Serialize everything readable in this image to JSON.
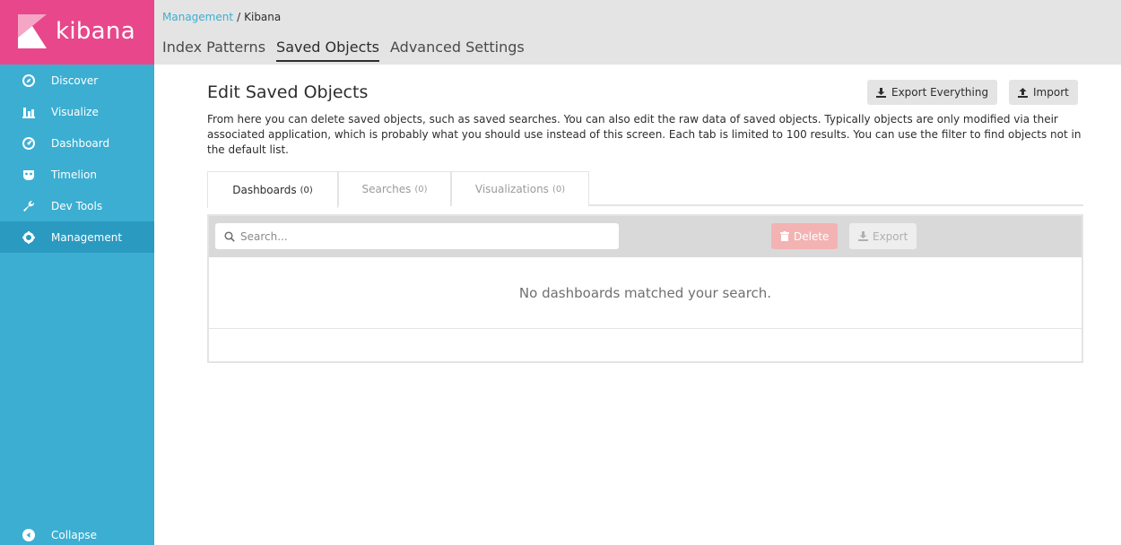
{
  "app": {
    "name": "kibana",
    "colors": {
      "brand": "#e8478b",
      "sidebar": "#3caed2",
      "sidebar_active": "#2a9ac1",
      "danger": "#f3b3b3"
    }
  },
  "sidebar": {
    "items": [
      {
        "label": "Discover",
        "icon": "compass-icon",
        "active": false
      },
      {
        "label": "Visualize",
        "icon": "bar-chart-icon",
        "active": false
      },
      {
        "label": "Dashboard",
        "icon": "gauge-icon",
        "active": false
      },
      {
        "label": "Timelion",
        "icon": "timelion-mask-icon",
        "active": false
      },
      {
        "label": "Dev Tools",
        "icon": "wrench-icon",
        "active": false
      },
      {
        "label": "Management",
        "icon": "gear-icon",
        "active": true
      }
    ],
    "collapse_label": "Collapse"
  },
  "breadcrumb": {
    "parent": "Management",
    "separator": "/",
    "current": "Kibana"
  },
  "top_tabs": [
    {
      "label": "Index Patterns",
      "active": false
    },
    {
      "label": "Saved Objects",
      "active": true
    },
    {
      "label": "Advanced Settings",
      "active": false
    }
  ],
  "page": {
    "title": "Edit Saved Objects",
    "export_everything_label": "Export Everything",
    "import_label": "Import",
    "description": "From here you can delete saved objects, such as saved searches. You can also edit the raw data of saved objects. Typically objects are only modified via their associated application, which is probably what you should use instead of this screen. Each tab is limited to 100 results. You can use the filter to find objects not in the default list."
  },
  "content_tabs": [
    {
      "label": "Dashboards",
      "count": "(0)",
      "active": true
    },
    {
      "label": "Searches",
      "count": "(0)",
      "active": false
    },
    {
      "label": "Visualizations",
      "count": "(0)",
      "active": false
    }
  ],
  "table": {
    "search_placeholder": "Search...",
    "delete_label": "Delete",
    "export_label": "Export",
    "empty_message": "No dashboards matched your search."
  }
}
